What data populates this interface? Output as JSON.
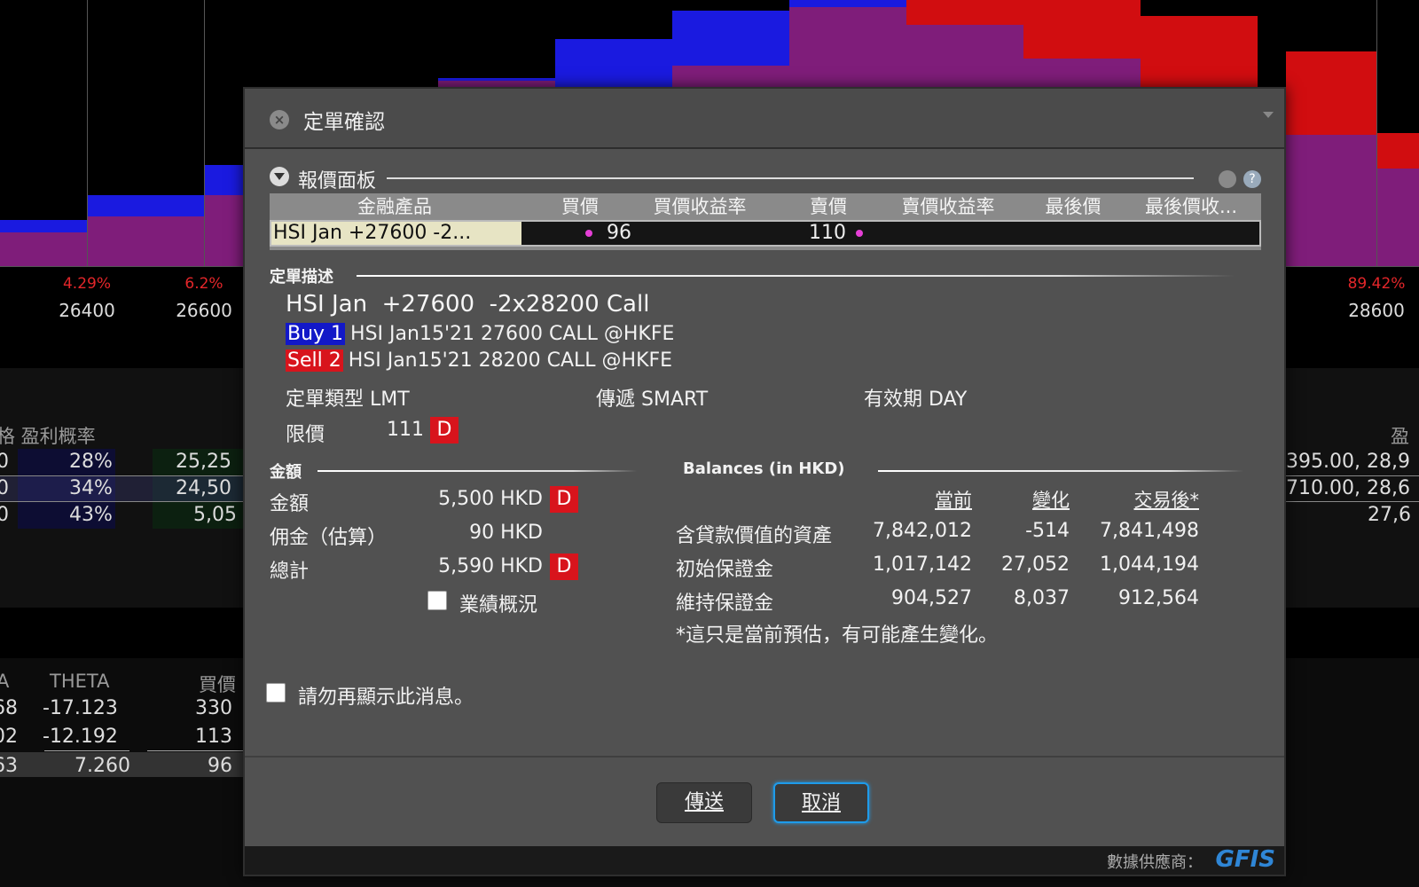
{
  "background": {
    "pct_labels": [
      "4.29%",
      "6.2%",
      "89.42%"
    ],
    "strikes": [
      "26400",
      "26600",
      "28600"
    ],
    "left_header": "格  盈利概率",
    "left_rows": [
      [
        "0",
        "28%",
        "25,25"
      ],
      [
        "0",
        "34%",
        "24,50"
      ],
      [
        "0",
        "43%",
        "5,05"
      ]
    ],
    "right_header": "盈",
    "right_rows": [
      "395.00, 28,9",
      "710.00, 28,6",
      "27,6"
    ],
    "greek_header": [
      "A",
      "THETA",
      "買價"
    ],
    "greek_rows": [
      [
        "68",
        "-17.123",
        "330"
      ],
      [
        "02",
        "-12.192",
        "113"
      ],
      [
        "63",
        "7.260",
        "96"
      ]
    ],
    "colors": {
      "blue": "#1a1ae0",
      "red": "#d10d10",
      "purple": "#7f1d7a"
    }
  },
  "dialog": {
    "title": "定單確認",
    "quote_panel": {
      "title": "報價面板",
      "columns": [
        "金融產品",
        "買價",
        "買價收益率",
        "賣價",
        "賣價收益率",
        "最後價",
        "最後價收..."
      ],
      "row": {
        "product": "HSI Jan +27600 -2...",
        "bid": "96",
        "ask": "110"
      }
    },
    "order_desc": {
      "section": "定單描述",
      "title": "HSI Jan  +27600  -2x28200 Call",
      "legs": [
        {
          "tag": "Buy 1",
          "text": "HSI Jan15'21 27600 CALL @HKFE"
        },
        {
          "tag": "Sell 2",
          "text": "HSI Jan15'21 28200 CALL @HKFE"
        }
      ],
      "order_type_label": "定單類型",
      "order_type": "LMT",
      "route_label": "傳遞",
      "route": "SMART",
      "tif_label": "有效期",
      "tif": "DAY",
      "limit_label": "限價",
      "limit": "111",
      "d": "D"
    },
    "amount": {
      "section": "金額",
      "rows": [
        {
          "label": "金額",
          "value": "5,500 HKD",
          "d": "D"
        },
        {
          "label": "佣金（估算）",
          "value": "90 HKD"
        },
        {
          "label": "總計",
          "value": "5,590 HKD",
          "d": "D"
        }
      ],
      "perf_label": "業績概況"
    },
    "balances": {
      "section": "Balances (in HKD)",
      "cols": [
        "當前",
        "變化",
        "交易後*"
      ],
      "rows": [
        {
          "label": "含貸款價值的資產",
          "values": [
            "7,842,012",
            "-514",
            "7,841,498"
          ]
        },
        {
          "label": "初始保證金",
          "values": [
            "1,017,142",
            "27,052",
            "1,044,194"
          ]
        },
        {
          "label": "維持保證金",
          "values": [
            "904,527",
            "8,037",
            "912,564"
          ]
        }
      ],
      "note": "*這只是當前預估，有可能產生變化。"
    },
    "dont_show": "請勿再顯示此消息。",
    "send": "傳送",
    "cancel": "取消",
    "footer": {
      "provider": "數據供應商：",
      "logo": "GFIS"
    }
  }
}
